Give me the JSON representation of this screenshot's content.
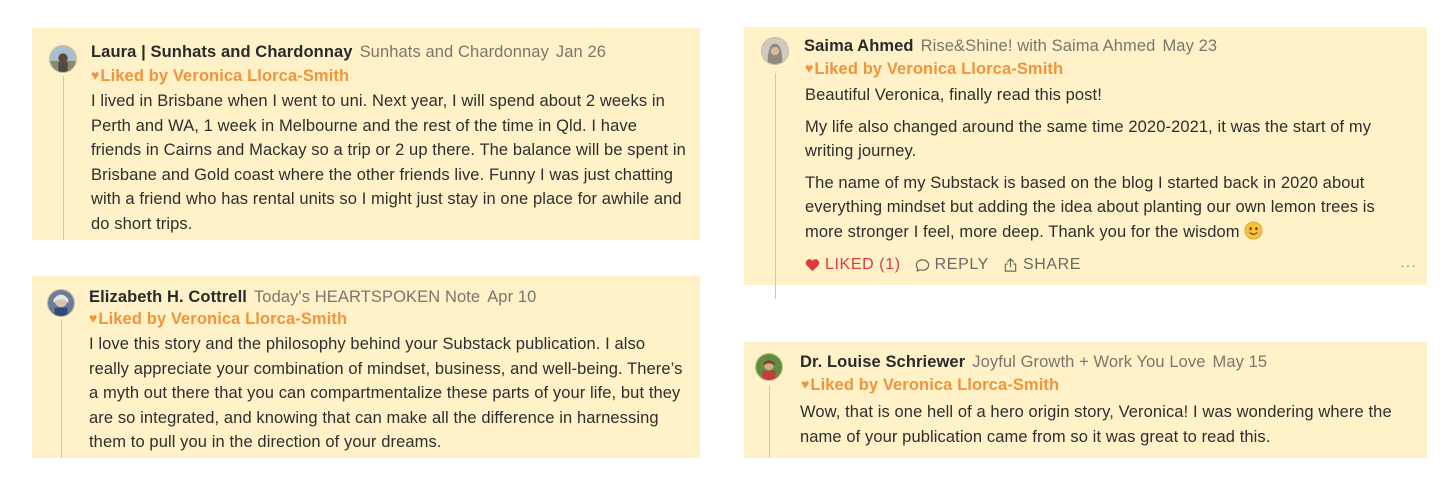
{
  "comments": [
    {
      "author": "Laura | Sunhats and Chardonnay",
      "publication": "Sunhats and Chardonnay",
      "date": "Jan 26",
      "liked_by": "Liked by Veronica Llorca-Smith",
      "paragraphs": [
        "I lived in Brisbane when I went to uni. Next year, I will spend about 2 weeks in Perth and WA, 1 week in Melbourne and the rest of the time in Qld. I have friends in Cairns and Mackay so a trip or 2 up there. The balance will be spent in Brisbane and Gold coast where the other friends live. Funny I was just chatting with a friend who has rental units so I might just stay in one place for awhile and do short trips."
      ]
    },
    {
      "author": "Elizabeth H. Cottrell",
      "publication": "Today's HEARTSPOKEN Note",
      "date": "Apr 10",
      "liked_by": "Liked by Veronica Llorca-Smith",
      "paragraphs": [
        "I love this story and the philosophy behind your Substack publication. I also really appreciate your combination of mindset, business, and well-being. There’s a myth out there that you can compartmentalize these parts of your life, but they are so integrated, and knowing that can make all the difference in harnessing them to pull you in the direction of your dreams."
      ]
    },
    {
      "author": "Saima Ahmed",
      "publication": "Rise&Shine! with Saima Ahmed",
      "date": "May 23",
      "liked_by": "Liked by Veronica Llorca-Smith",
      "paragraphs": [
        "Beautiful Veronica, finally read this post!",
        "My life also changed around the same time 2020-2021, it was the start of my writing journey.",
        "The name of my Substack is based on the blog I started back in 2020 about everything mindset but adding the idea about planting our own lemon trees is more stronger I feel, more deep. Thank you for the wisdom"
      ],
      "actions": {
        "liked": "LIKED (1)",
        "reply": "REPLY",
        "share": "SHARE",
        "more": "···"
      }
    },
    {
      "author": "Dr. Louise Schriewer",
      "publication": "Joyful Growth + Work You Love",
      "date": "May 15",
      "liked_by": "Liked by Veronica Llorca-Smith",
      "paragraphs": [
        "Wow, that is one hell of a hero origin story, Veronica! I was wondering where the name of your publication came from so it was great to read this."
      ]
    }
  ],
  "icons": {
    "heart": "heart-icon",
    "comment": "comment-bubble-icon",
    "share": "share-icon",
    "smile": "smiling-face-emoji"
  },
  "colors": {
    "card_bg": "#fff2c9",
    "liked_text": "#f1943b",
    "liked_action": "#e0393e",
    "meta_text": "#7a766c"
  }
}
